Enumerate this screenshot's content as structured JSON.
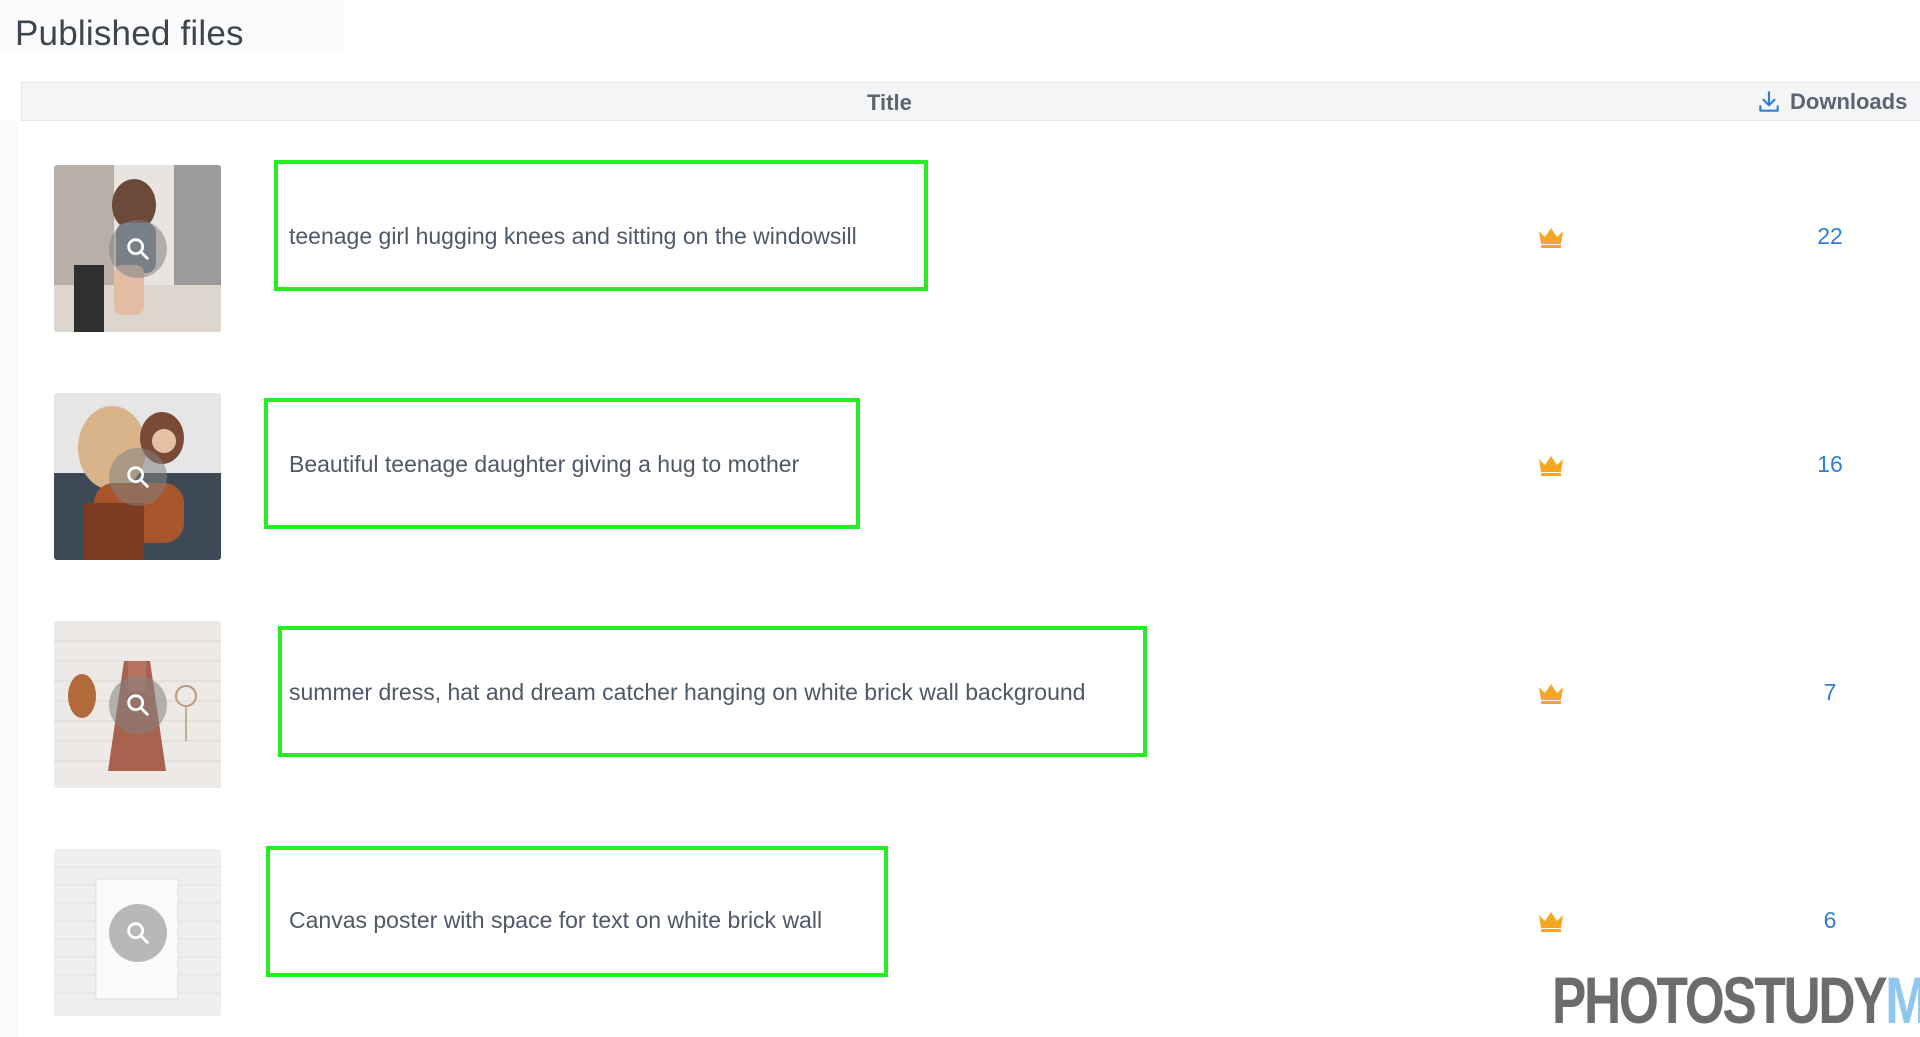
{
  "page": {
    "title": "Published files"
  },
  "table": {
    "headers": {
      "title": "Title",
      "downloads": "Downloads"
    },
    "rows": [
      {
        "title": "teenage girl hugging knees and sitting on the windowsill",
        "downloads": "22",
        "thumbnail": "girl-on-windowsill"
      },
      {
        "title": "Beautiful teenage daughter giving a hug to mother",
        "downloads": "16",
        "thumbnail": "daughter-hugging-mother"
      },
      {
        "title": "summer dress, hat and dream catcher hanging on white brick wall background",
        "downloads": "7",
        "thumbnail": "dress-hat-dreamcatcher"
      },
      {
        "title": "Canvas poster with space for text on white brick wall",
        "downloads": "6",
        "thumbnail": "canvas-on-brick-wall"
      }
    ]
  },
  "icons": {
    "download": "download-icon",
    "zoom": "magnifier-icon",
    "premium": "crown-icon"
  },
  "colors": {
    "highlight_box": "#22ee22",
    "downloads_count": "#2f7fd8",
    "crown": "#f5a623",
    "watermark_main": "#6c6c6c",
    "watermark_accent": "#8fc7ef"
  },
  "watermark": {
    "main": "PHOTOSTUDY",
    "accent": "ME"
  }
}
